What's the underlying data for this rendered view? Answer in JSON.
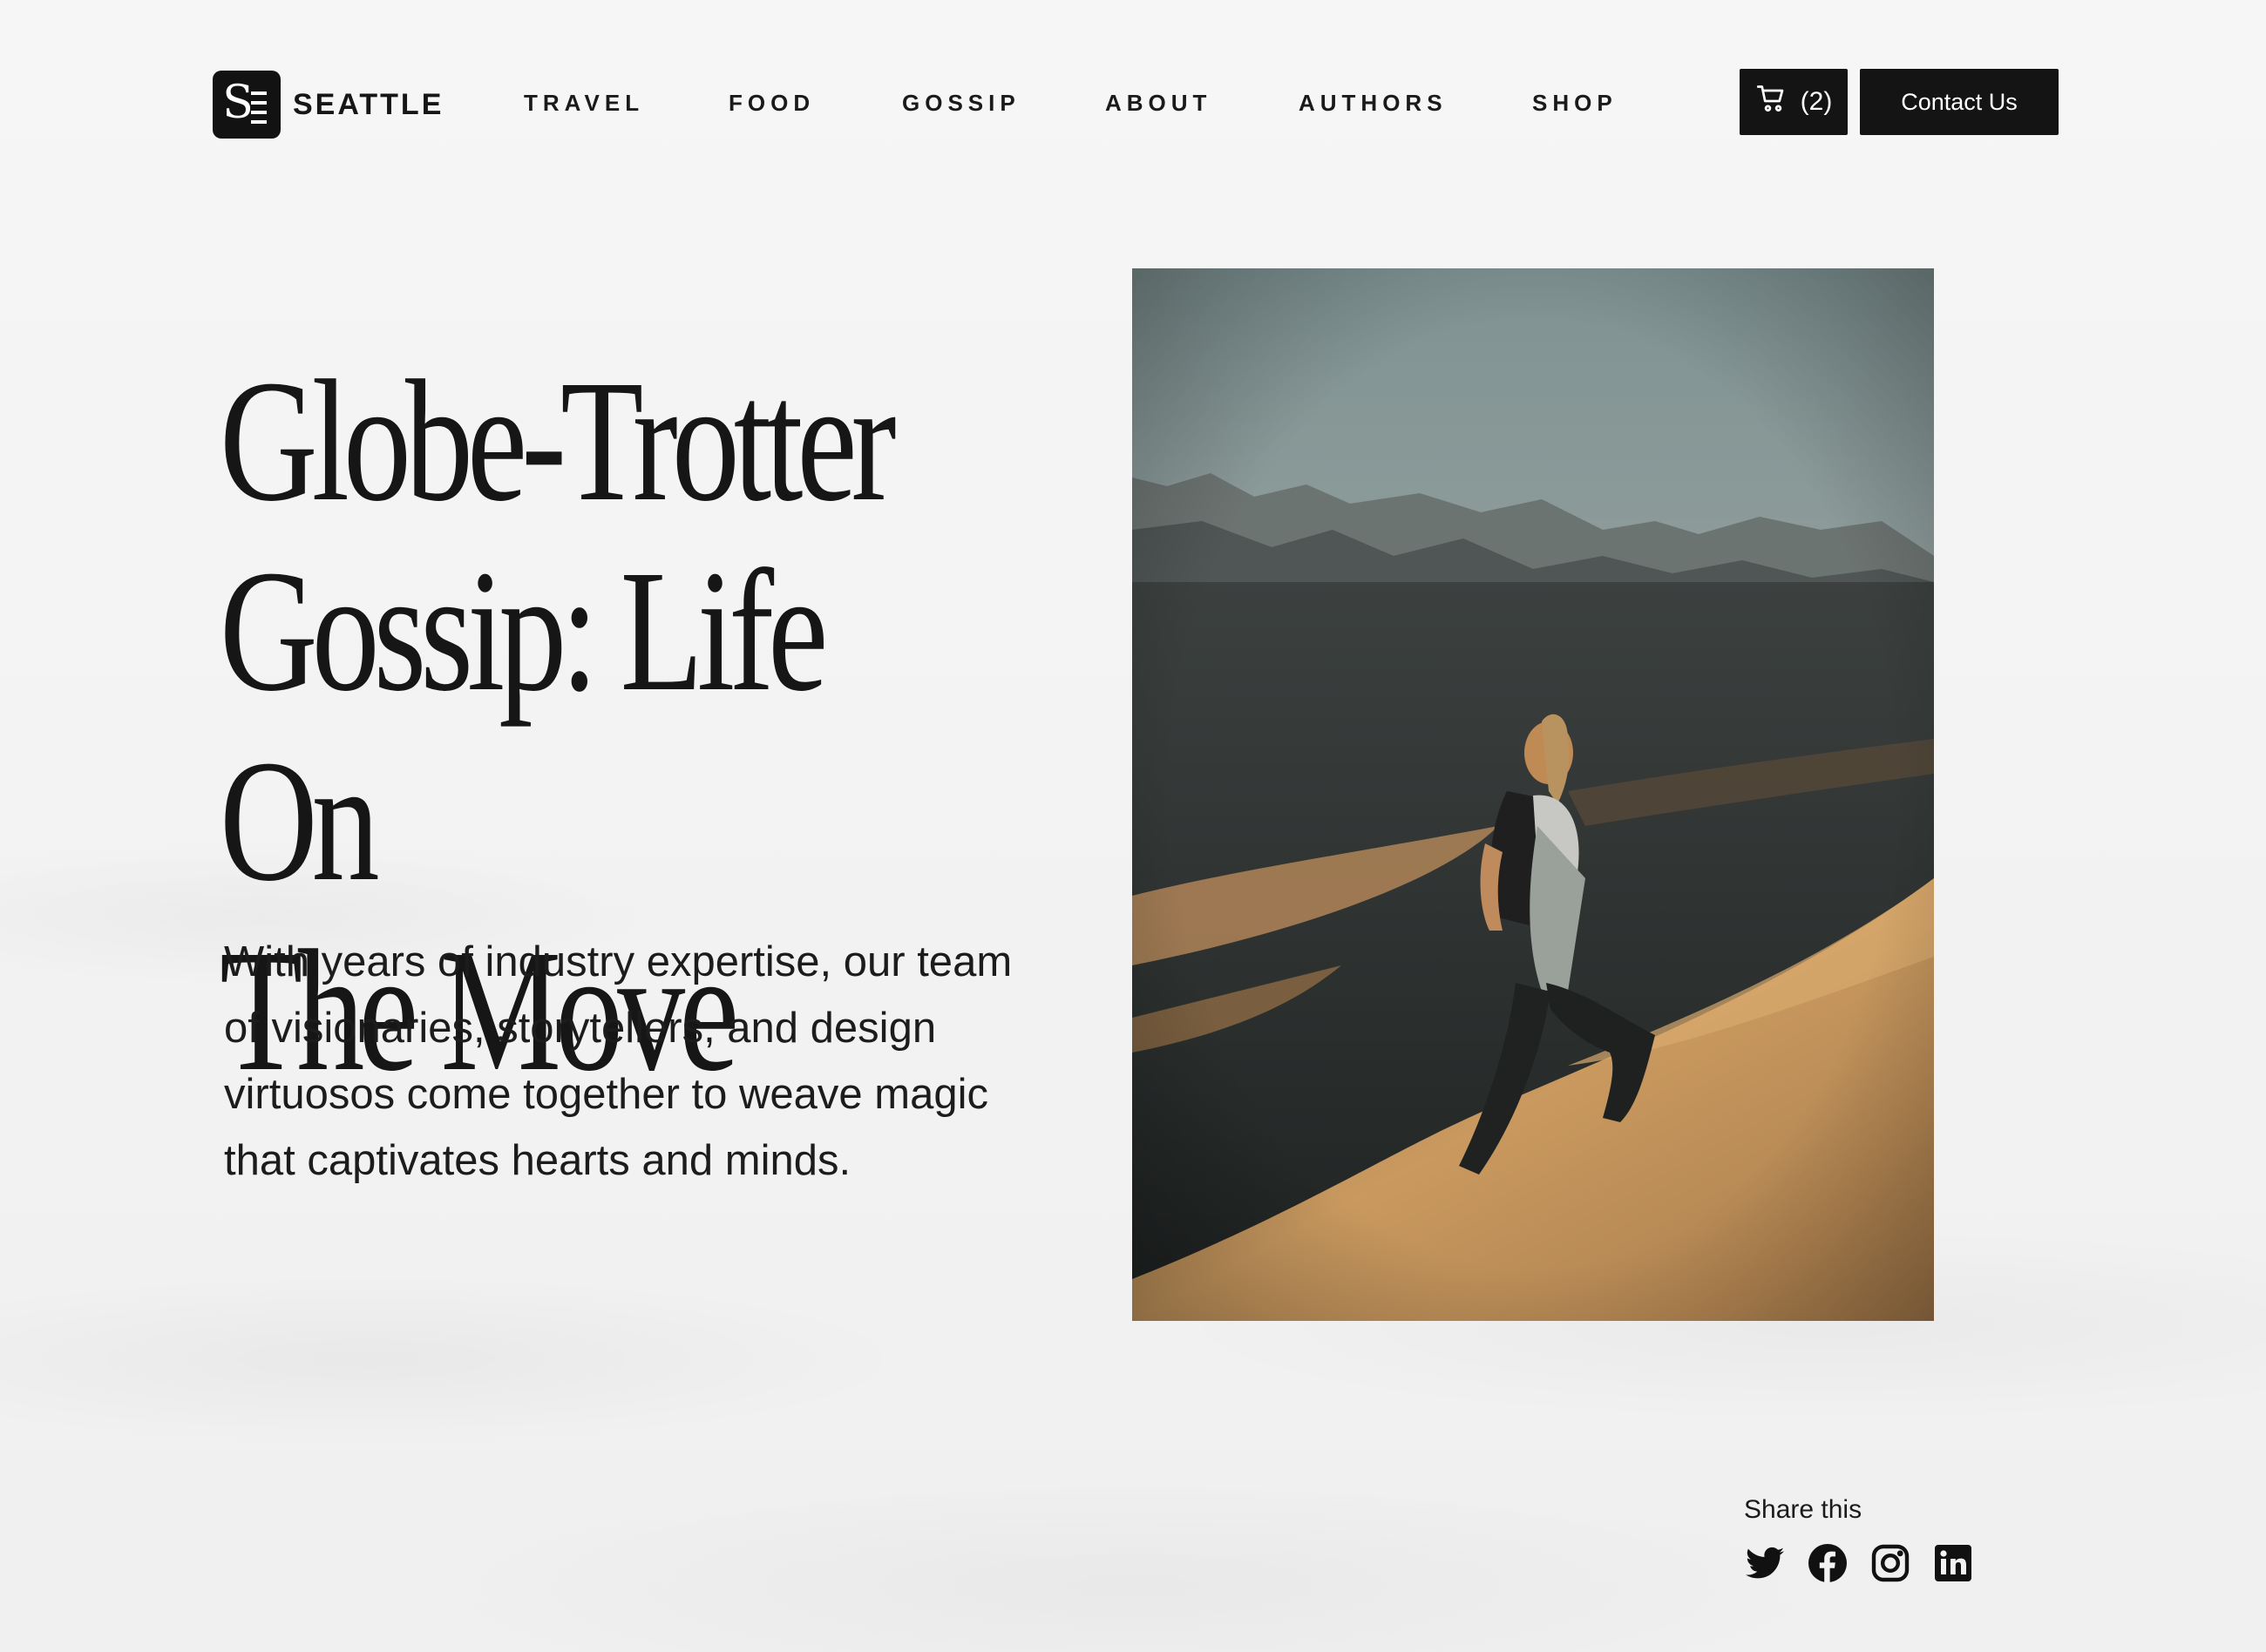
{
  "brand": {
    "name": "SEATTLE",
    "mark_letter": "S"
  },
  "nav": [
    {
      "label": "TRAVEL"
    },
    {
      "label": "FOOD"
    },
    {
      "label": "GOSSIP"
    },
    {
      "label": "ABOUT"
    },
    {
      "label": "AUTHORS"
    },
    {
      "label": "SHOP"
    }
  ],
  "header": {
    "cart_count": "(2)",
    "contact_label": "Contact Us"
  },
  "hero": {
    "title_lines": [
      "Globe-Trotter",
      "Gossip: Life On",
      "The Move"
    ],
    "description": "With years of industry expertise, our team of visionaries, storytellers, and design virtuosos come together to weave magic that captivates hearts and minds."
  },
  "share": {
    "label": "Share this",
    "icons": [
      "twitter-icon",
      "facebook-icon",
      "instagram-icon",
      "linkedin-icon"
    ]
  },
  "colors": {
    "accent": "#141414",
    "background": "#f3f3f3",
    "text": "#161616"
  }
}
